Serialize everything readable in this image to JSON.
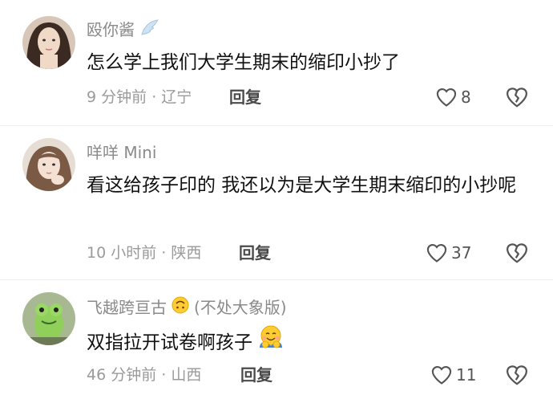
{
  "comments": [
    {
      "username": "殴你酱",
      "text": "怎么学上我们大学生期末的缩印小抄了",
      "time": "9 分钟前",
      "location": "辽宁",
      "reply_label": "回复",
      "likes": "8",
      "badge_icon": "wing-icon"
    },
    {
      "username": "咩咩 Mini",
      "text": "看这给孩子印的 我还以为是大学生期末缩印的小抄呢",
      "time": "10 小时前",
      "location": "陕西",
      "reply_label": "回复",
      "likes": "37"
    },
    {
      "username": "飞越跨亘古",
      "username_suffix": "(不处大象版)",
      "text": "双指拉开试卷啊孩子",
      "time": "46 分钟前",
      "location": "山西",
      "reply_label": "回复",
      "likes": "11",
      "name_emoji": "upside-down-face-emoji",
      "text_emoji": "hugging-emoji"
    }
  ],
  "separator": "·"
}
